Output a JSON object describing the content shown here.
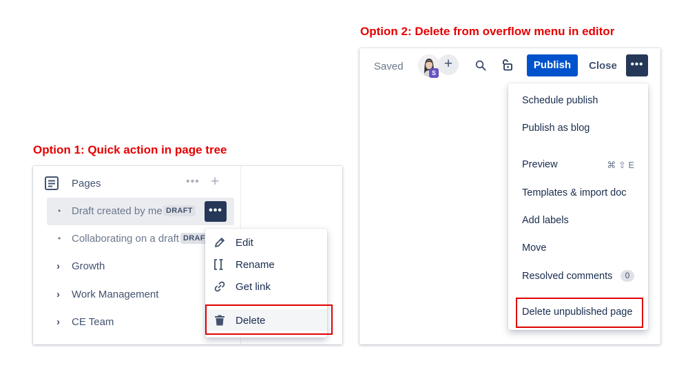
{
  "captions": {
    "option1": "Option 1: Quick action in page tree",
    "option2": "Option 2: Delete from overflow menu in editor"
  },
  "colors": {
    "caption_red": "#e60000",
    "highlight_box": "#e00000",
    "primary_blue": "#0052cc",
    "dark_button": "#253858"
  },
  "page_tree": {
    "title": "Pages",
    "header_more": "•••",
    "header_add": "+",
    "items": [
      {
        "label": "Draft created by me",
        "badge": "DRAFT",
        "type": "bullet",
        "selected": true
      },
      {
        "label": "Collaborating on a draft",
        "badge": "DRAF",
        "type": "bullet"
      },
      {
        "label": "Growth",
        "type": "chevron"
      },
      {
        "label": "Work Management",
        "type": "chevron"
      },
      {
        "label": "CE Team",
        "type": "chevron"
      }
    ],
    "row_more": "•••",
    "bullet_glyph": "•",
    "chevron_glyph": "›",
    "context_menu": {
      "edit": "Edit",
      "rename": "Rename",
      "get_link": "Get link",
      "delete": "Delete"
    }
  },
  "editor": {
    "saved": "Saved",
    "avatar_badge": "S",
    "add_glyph": "+",
    "publish": "Publish",
    "close": "Close",
    "overflow_glyph": "•••",
    "overflow_menu": {
      "schedule_publish": "Schedule publish",
      "publish_as_blog": "Publish as blog",
      "preview": "Preview",
      "preview_shortcut": "⌘ ⇧ E",
      "templates": "Templates & import doc",
      "add_labels": "Add labels",
      "move": "Move",
      "resolved_comments": "Resolved comments",
      "resolved_count": "0",
      "delete_unpublished": "Delete unpublished page"
    }
  }
}
